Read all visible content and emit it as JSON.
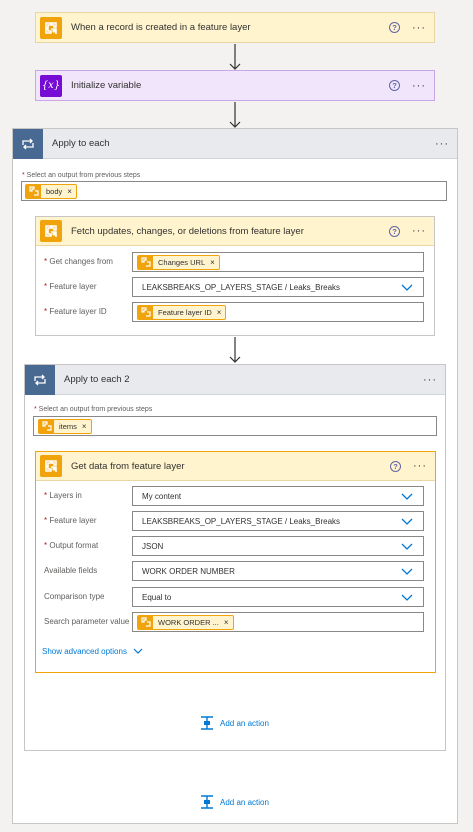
{
  "trigger": {
    "title": "When a record is created in a feature layer",
    "help": "?",
    "more": "···",
    "icon": "gis-icon"
  },
  "init_var": {
    "title": "Initialize variable",
    "help": "?",
    "more": "···",
    "icon": "variable-icon"
  },
  "apply1": {
    "title": "Apply to each",
    "more": "···",
    "select_label": "Select an output from previous steps",
    "token": "body",
    "fetch": {
      "title": "Fetch updates, changes, or deletions from feature layer",
      "help": "?",
      "more": "···",
      "fields": [
        {
          "label": "Get changes from",
          "token": "Changes URL"
        },
        {
          "label": "Feature layer",
          "value": "LEAKSBREAKS_OP_LAYERS_STAGE / Leaks_Breaks"
        },
        {
          "label": "Feature layer ID",
          "token": "Feature layer ID"
        }
      ]
    },
    "apply2": {
      "title": "Apply to each 2",
      "more": "···",
      "select_label": "Select an output from previous steps",
      "token": "items",
      "getdata": {
        "title": "Get data from feature layer",
        "help": "?",
        "more": "···",
        "fields": [
          {
            "label": "Layers in",
            "value": "My content"
          },
          {
            "label": "Feature layer",
            "value": "LEAKSBREAKS_OP_LAYERS_STAGE / Leaks_Breaks"
          },
          {
            "label": "Output format",
            "value": "JSON"
          },
          {
            "label": "Available fields",
            "value": "WORK ORDER NUMBER"
          },
          {
            "label": "Comparison type",
            "value": "Equal to"
          },
          {
            "label": "Search parameter value",
            "token": "WORK ORDER ..."
          }
        ],
        "advanced": "Show advanced options"
      },
      "add_action": "Add an action"
    },
    "add_action": "Add an action"
  },
  "colors": {
    "gis": "#f0a30a",
    "variable": "#770bd6",
    "loop": "#486991",
    "link": "#0078d4"
  }
}
